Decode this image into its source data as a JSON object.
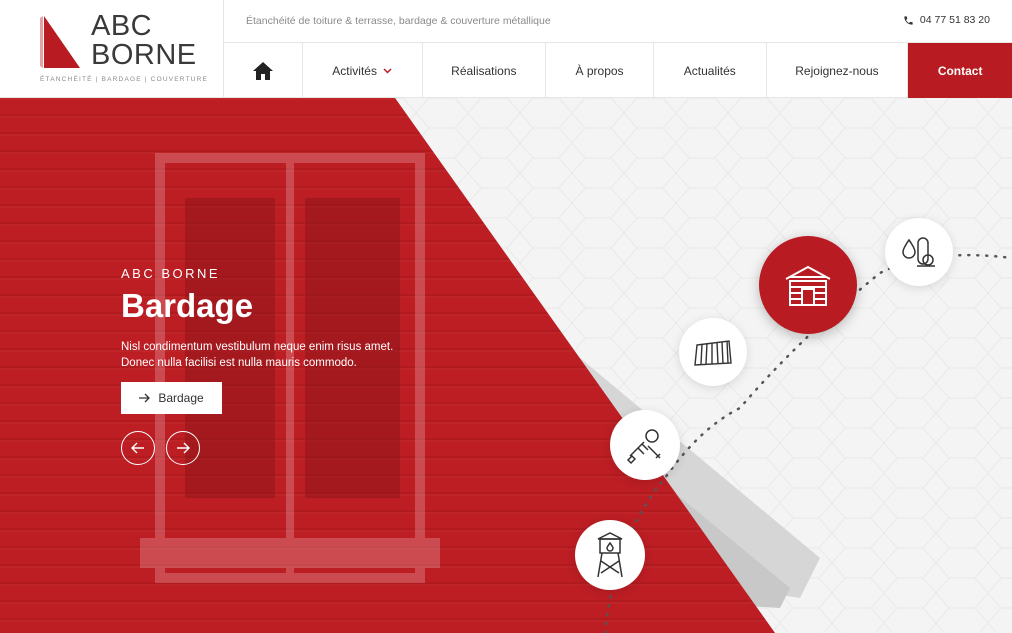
{
  "brand": {
    "name": "ABC\nBORNE",
    "tagline_small": "ÉTANCHÉITÉ | BARDAGE | COUVERTURE"
  },
  "topbar": {
    "tagline": "Étanchéité de toiture & terrasse, bardage & couverture métallique",
    "phone": "04 77 51 83 20"
  },
  "nav": {
    "activities": "Activités",
    "achievements": "Réalisations",
    "about": "À propos",
    "news": "Actualités",
    "join": "Rejoignez-nous",
    "contact": "Contact"
  },
  "hero": {
    "eyebrow": "ABC BORNE",
    "title": "Bardage",
    "description": "Nisl condimentum vestibulum neque enim risus amet. Donec nulla facilisi est nulla mauris commodo.",
    "cta_label": "Bardage"
  },
  "services": {
    "items": [
      "etancheite-icon",
      "bardage-icon",
      "couverture-icon",
      "depannage-icon",
      "reservoir-icon"
    ],
    "active": "bardage-icon"
  },
  "colors": {
    "accent": "#b81b21",
    "text": "#333333",
    "muted": "#8a8a8a"
  }
}
